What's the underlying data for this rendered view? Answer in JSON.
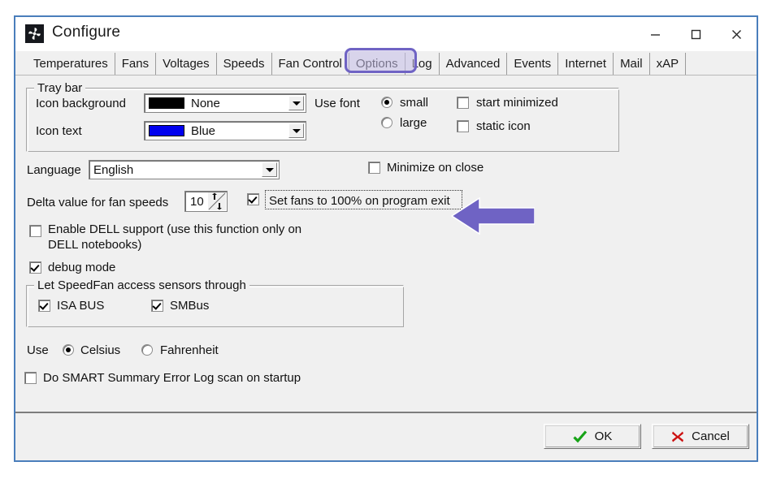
{
  "window": {
    "title": "Configure",
    "icon": "fan-icon",
    "controls": {
      "minimize": "minimize-icon",
      "maximize": "maximize-icon",
      "close": "close-icon"
    },
    "border_color": "#4a7ebb"
  },
  "tabs": [
    {
      "label": "Temperatures",
      "selected": false
    },
    {
      "label": "Fans",
      "selected": false
    },
    {
      "label": "Voltages",
      "selected": false
    },
    {
      "label": "Speeds",
      "selected": false
    },
    {
      "label": "Fan Control",
      "selected": false
    },
    {
      "label": "Options",
      "selected": true
    },
    {
      "label": "Log",
      "selected": false
    },
    {
      "label": "Advanced",
      "selected": false
    },
    {
      "label": "Events",
      "selected": false
    },
    {
      "label": "Internet",
      "selected": false
    },
    {
      "label": "Mail",
      "selected": false
    },
    {
      "label": "xAP",
      "selected": false
    }
  ],
  "annotation": {
    "tab_highlight_color": "#6f63c4",
    "arrow_color": "#6f63c4",
    "arrow_direction": "left",
    "points_at": "Set fans to 100% on program exit"
  },
  "tray_bar": {
    "group_title": "Tray bar",
    "icon_background": {
      "label": "Icon background",
      "value": "None",
      "swatch_color": "#000000"
    },
    "icon_text": {
      "label": "Icon text",
      "value": "Blue",
      "swatch_color": "#0000ee"
    },
    "use_font": {
      "label": "Use font",
      "options": [
        "small",
        "large"
      ],
      "selected": "small"
    },
    "checkboxes": [
      {
        "label": "start minimized",
        "checked": false
      },
      {
        "label": "static icon",
        "checked": false
      }
    ]
  },
  "language": {
    "label": "Language",
    "value": "English"
  },
  "minimize_on_close": {
    "label": "Minimize on close",
    "checked": false
  },
  "delta": {
    "label": "Delta value for fan speeds",
    "value": "10"
  },
  "set_fans_100": {
    "label": "Set fans to 100% on program exit",
    "checked": true,
    "focused": true
  },
  "dell_support": {
    "label_line1": "Enable DELL support (use this function only on",
    "label_line2": "DELL notebooks)",
    "checked": false
  },
  "debug_mode": {
    "label": "debug mode",
    "checked": true
  },
  "sensors": {
    "group_title": "Let SpeedFan access sensors through",
    "items": [
      {
        "label": "ISA BUS",
        "checked": true
      },
      {
        "label": "SMBus",
        "checked": true
      }
    ]
  },
  "temperature_unit": {
    "label": "Use",
    "options": [
      "Celsius",
      "Fahrenheit"
    ],
    "selected": "Celsius"
  },
  "smart_scan": {
    "label": "Do SMART Summary Error Log scan on startup",
    "checked": false
  },
  "footer": {
    "ok_label": "OK",
    "cancel_label": "Cancel",
    "ok_icon_color": "#17a317",
    "cancel_icon_color": "#cc1111"
  }
}
